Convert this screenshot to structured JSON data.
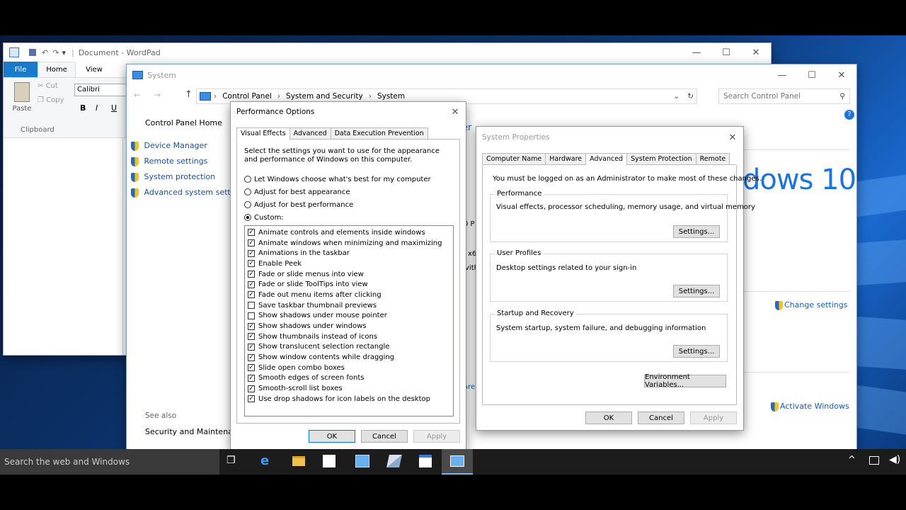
{
  "wordpad": {
    "title": "Document - WordPad",
    "ribbon_tabs": [
      "File",
      "Home",
      "View"
    ],
    "paste_label": "Paste",
    "cut_label": "Cut",
    "copy_label": "Copy",
    "clipboard_label": "Clipboard",
    "font_name": "Calibri",
    "bold": "B",
    "italic": "I",
    "underline": "U"
  },
  "system": {
    "title": "System",
    "breadcrumb": [
      "Control Panel",
      "System and Security",
      "System"
    ],
    "search_placeholder": "Search Control Panel",
    "sidebar_home": "Control Panel Home",
    "sidebar_items": [
      "Device Manager",
      "Remote settings",
      "System protection",
      "Advanced system settings"
    ],
    "see_also": "See also",
    "security_maint": "Security and Maintenance",
    "win10_logo": "dows 10",
    "change_settings": "Change settings",
    "activate_windows": "Activate Windows",
    "partial_er": "er",
    "partial_op": "0 P",
    "partial_x6": "x6",
    "partial_vith": "vith",
    "partial_are": "are"
  },
  "perf": {
    "title": "Performance Options",
    "tabs": [
      "Visual Effects",
      "Advanced",
      "Data Execution Prevention"
    ],
    "description": "Select the settings you want to use for the appearance and performance of Windows on this computer.",
    "radios": [
      {
        "label": "Let Windows choose what's best for my computer",
        "selected": false
      },
      {
        "label": "Adjust for best appearance",
        "selected": false
      },
      {
        "label": "Adjust for best performance",
        "selected": false
      },
      {
        "label": "Custom:",
        "selected": true
      }
    ],
    "options": [
      {
        "label": "Animate controls and elements inside windows",
        "checked": true
      },
      {
        "label": "Animate windows when minimizing and maximizing",
        "checked": true
      },
      {
        "label": "Animations in the taskbar",
        "checked": true
      },
      {
        "label": "Enable Peek",
        "checked": true
      },
      {
        "label": "Fade or slide menus into view",
        "checked": true
      },
      {
        "label": "Fade or slide ToolTips into view",
        "checked": true
      },
      {
        "label": "Fade out menu items after clicking",
        "checked": true
      },
      {
        "label": "Save taskbar thumbnail previews",
        "checked": false
      },
      {
        "label": "Show shadows under mouse pointer",
        "checked": false
      },
      {
        "label": "Show shadows under windows",
        "checked": true
      },
      {
        "label": "Show thumbnails instead of icons",
        "checked": true
      },
      {
        "label": "Show translucent selection rectangle",
        "checked": true
      },
      {
        "label": "Show window contents while dragging",
        "checked": true
      },
      {
        "label": "Slide open combo boxes",
        "checked": true
      },
      {
        "label": "Smooth edges of screen fonts",
        "checked": true
      },
      {
        "label": "Smooth-scroll list boxes",
        "checked": true
      },
      {
        "label": "Use drop shadows for icon labels on the desktop",
        "checked": true
      }
    ],
    "ok": "OK",
    "cancel": "Cancel",
    "apply": "Apply"
  },
  "sysprops": {
    "title": "System Properties",
    "tabs": [
      "Computer Name",
      "Hardware",
      "Advanced",
      "System Protection",
      "Remote"
    ],
    "admin_note": "You must be logged on as an Administrator to make most of these changes.",
    "performance_title": "Performance",
    "performance_desc": "Visual effects, processor scheduling, memory usage, and virtual memory",
    "profiles_title": "User Profiles",
    "profiles_desc": "Desktop settings related to your sign-in",
    "startup_title": "Startup and Recovery",
    "startup_desc": "System startup, system failure, and debugging information",
    "settings_btn": "Settings...",
    "env_btn": "Environment Variables...",
    "ok": "OK",
    "cancel": "Cancel",
    "apply": "Apply"
  },
  "taskbar": {
    "search_placeholder": "Search the web and Windows"
  },
  "colors": {
    "accent": "#0078d7",
    "link": "#1a5fb4",
    "taskbar": "#1c1c1c"
  }
}
